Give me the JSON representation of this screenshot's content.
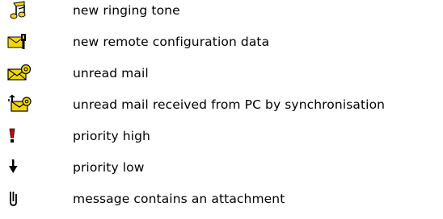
{
  "legend": {
    "items": [
      {
        "icon": "ringing-tone-icon",
        "label": "new ringing tone"
      },
      {
        "icon": "remote-configuration-icon",
        "label": "new remote configuration data"
      },
      {
        "icon": "unread-mail-icon",
        "label": "unread mail"
      },
      {
        "icon": "synchronised-mail-icon",
        "label": "unread mail received from PC by synchronisation"
      },
      {
        "icon": "priority-high-icon",
        "label": "priority high"
      },
      {
        "icon": "priority-low-icon",
        "label": "priority low"
      },
      {
        "icon": "attachment-icon",
        "label": "message contains an attachment"
      }
    ]
  },
  "colors": {
    "icon_yellow": "#f7d600",
    "icon_outline": "#000000",
    "priority_red": "#d40000",
    "text": "#000000",
    "background": "#ffffff"
  }
}
